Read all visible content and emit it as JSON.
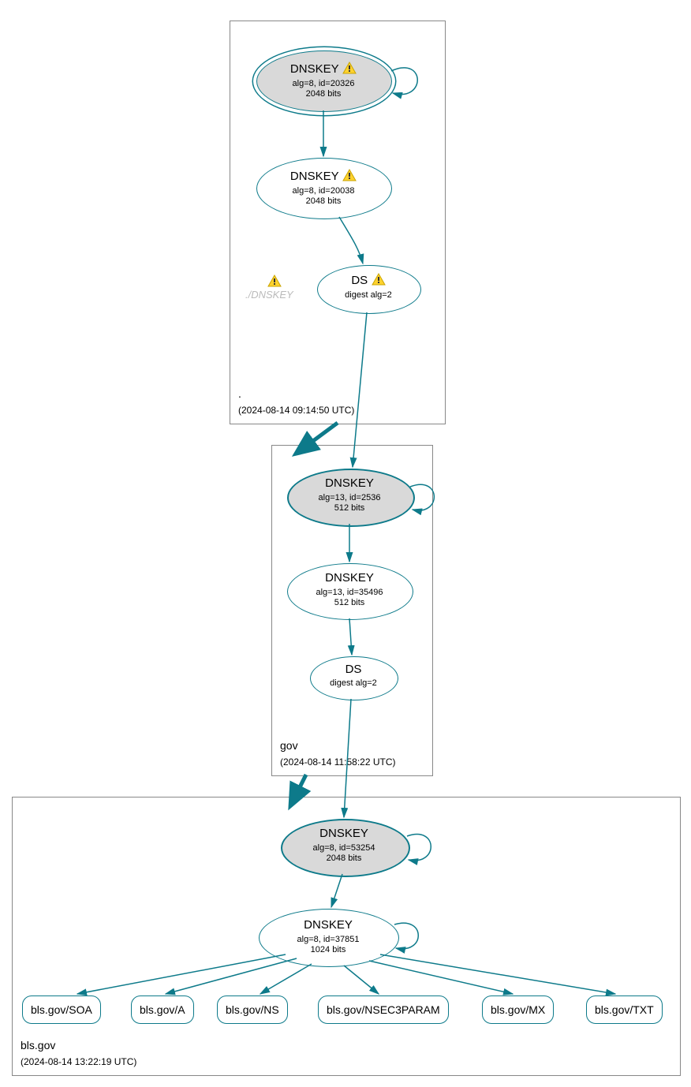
{
  "zones": {
    "root": {
      "name": ".",
      "timestamp": "(2024-08-14 09:14:50 UTC)",
      "ksk": {
        "title": "DNSKEY",
        "line1": "alg=8, id=20326",
        "line2": "2048 bits",
        "warn": true
      },
      "zsk": {
        "title": "DNSKEY",
        "line1": "alg=8, id=20038",
        "line2": "2048 bits",
        "warn": true
      },
      "ds": {
        "title": "DS",
        "line1": "digest alg=2",
        "warn": true
      },
      "ghost_dnskey": "./DNSKEY"
    },
    "gov": {
      "name": "gov",
      "timestamp": "(2024-08-14 11:58:22 UTC)",
      "ksk": {
        "title": "DNSKEY",
        "line1": "alg=13, id=2536",
        "line2": "512 bits"
      },
      "zsk": {
        "title": "DNSKEY",
        "line1": "alg=13, id=35496",
        "line2": "512 bits"
      },
      "ds": {
        "title": "DS",
        "line1": "digest alg=2"
      }
    },
    "bls": {
      "name": "bls.gov",
      "timestamp": "(2024-08-14 13:22:19 UTC)",
      "ksk": {
        "title": "DNSKEY",
        "line1": "alg=8, id=53254",
        "line2": "2048 bits"
      },
      "zsk": {
        "title": "DNSKEY",
        "line1": "alg=8, id=37851",
        "line2": "1024 bits"
      },
      "rrsets": {
        "soa": "bls.gov/SOA",
        "a": "bls.gov/A",
        "ns": "bls.gov/NS",
        "nsec3param": "bls.gov/NSEC3PARAM",
        "mx": "bls.gov/MX",
        "txt": "bls.gov/TXT"
      }
    }
  }
}
